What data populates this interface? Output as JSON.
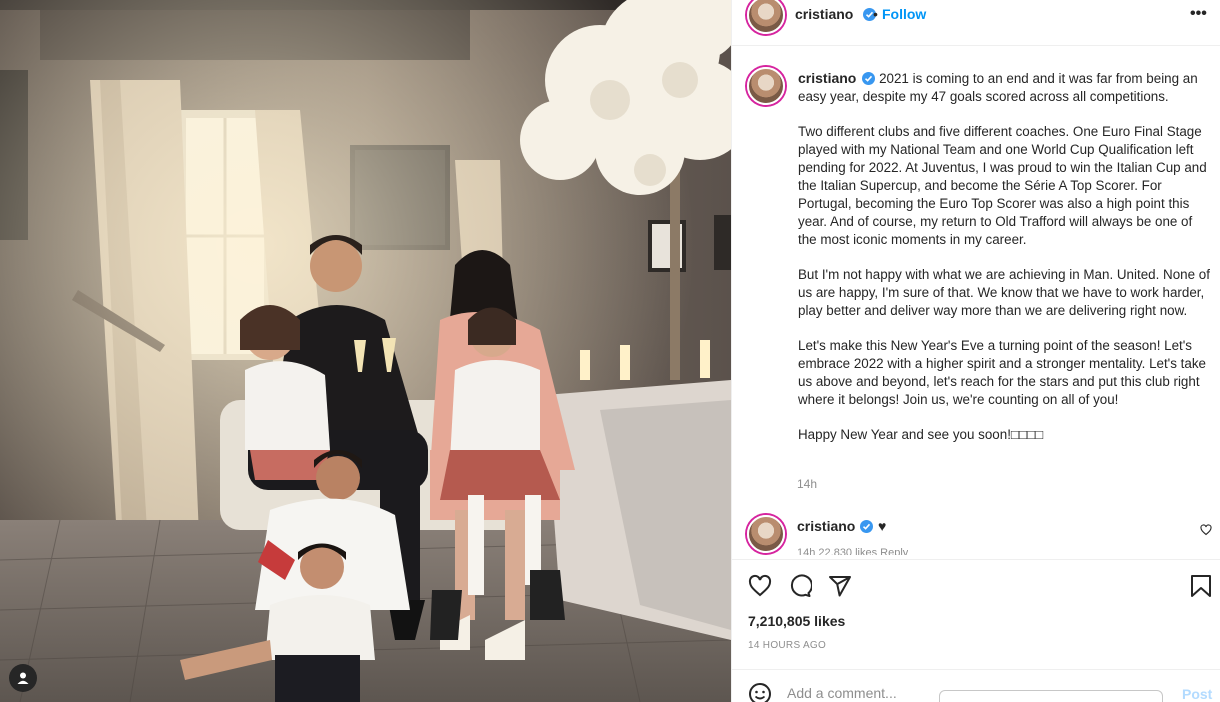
{
  "header": {
    "username": "cristiano",
    "separator": "•",
    "follow_label": "Follow",
    "more_label": "•••"
  },
  "caption": {
    "username": "cristiano",
    "paragraphs": [
      "2021 is coming to an end and it was far from being an easy year, despite my 47 goals scored across all competitions.",
      "Two different clubs and five different coaches. One Euro Final Stage played with my National Team and one World Cup Qualification left pending for 2022. At Juventus, I was proud to win the Italian Cup and the Italian Supercup, and become the Série A Top Scorer. For Portugal, becoming the Euro Top Scorer was also a high point this year. And of course, my return to Old Trafford will always be one of the most iconic moments in my career.",
      "But I'm not happy with what we are achieving in Man. United. None of us are happy, I'm sure of that. We know that we have to work harder, play better and deliver way more than we are delivering right now.",
      "Let's make this New Year's Eve a turning point of the season! Let's embrace 2022 with a higher spirit and a stronger mentality. Let's take us above and beyond, let's reach for the stars and put this club right where it belongs! Join us, we're counting on all of you!",
      "Happy New Year and see you soon!□□□□"
    ],
    "time": "14h"
  },
  "comment": {
    "username": "cristiano",
    "text": "♥",
    "meta": "14h   22,830 likes   Reply"
  },
  "post": {
    "likes": "7,210,805 likes",
    "ago": "14 HOURS AGO"
  },
  "add_comment": {
    "placeholder": "Add a comment...",
    "post_label": "Post"
  },
  "colors": {
    "link_blue": "#0095f6",
    "verified_blue": "#3897f0",
    "post_disabled": "#b3dbff",
    "meta_gray": "#8e8e8e"
  },
  "icons": [
    "verified-badge-icon",
    "more-options-icon",
    "heart-icon",
    "comment-icon",
    "share-icon",
    "bookmark-icon",
    "emoji-icon",
    "user-tag-icon"
  ]
}
